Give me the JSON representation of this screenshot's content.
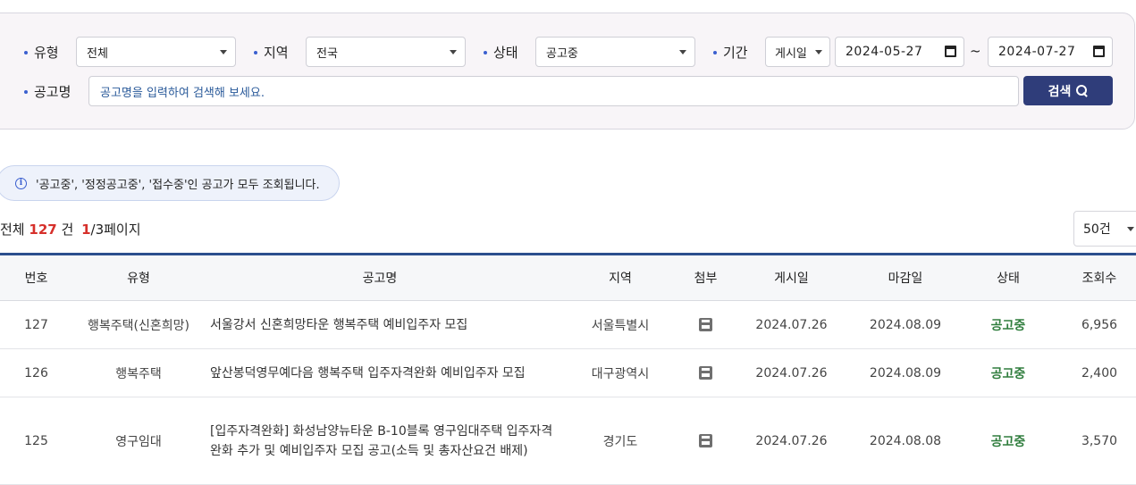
{
  "filters": {
    "type_label": "유형",
    "type_value": "전체",
    "region_label": "지역",
    "region_value": "전국",
    "status_label": "상태",
    "status_value": "공고중",
    "period_label": "기간",
    "period_kind": "게시일",
    "date_from": "2024-05-27",
    "date_sep": "~",
    "date_to": "2024-07-27",
    "name_label": "공고명",
    "name_placeholder": "공고명을 입력하여 검색해 보세요.",
    "search_button": "검색"
  },
  "notice": {
    "icon": "info-icon",
    "text": "'공고중', '정정공고중', '접수중'인 공고가 모두 조회됩니다."
  },
  "summary": {
    "prefix": "전체",
    "total": "127",
    "unit": "건",
    "current_page": "1",
    "page_rest": "/3페이지",
    "page_size": "50건"
  },
  "table": {
    "headers": [
      "번호",
      "유형",
      "공고명",
      "지역",
      "첨부",
      "게시일",
      "마감일",
      "상태",
      "조회수"
    ],
    "rows": [
      {
        "no": "127",
        "type": "행복주택(신혼희망)",
        "title": "서울강서 신혼희망타운 행복주택 예비입주자 모집",
        "region": "서울특별시",
        "attach_icon": "file-icon",
        "posted": "2024.07.26",
        "deadline": "2024.08.09",
        "status": "공고중",
        "views": "6,956"
      },
      {
        "no": "126",
        "type": "행복주택",
        "title": "앞산봉덕영무예다음 행복주택 입주자격완화 예비입주자 모집",
        "region": "대구광역시",
        "attach_icon": "file-icon",
        "posted": "2024.07.26",
        "deadline": "2024.08.09",
        "status": "공고중",
        "views": "2,400"
      },
      {
        "no": "125",
        "type": "영구임대",
        "title": "[입주자격완화] 화성남양뉴타운 B-10블록 영구임대주택 입주자격완화 추가 및 예비입주자 모집 공고(소득 및 총자산요건 배제)",
        "region": "경기도",
        "attach_icon": "file-icon",
        "posted": "2024.07.26",
        "deadline": "2024.08.08",
        "status": "공고중",
        "views": "3,570"
      }
    ]
  },
  "colors": {
    "accent": "#2f3d7a",
    "status_green": "#2f7d3d",
    "count_red": "#d6302b",
    "table_top_border": "#2b4f8e"
  }
}
